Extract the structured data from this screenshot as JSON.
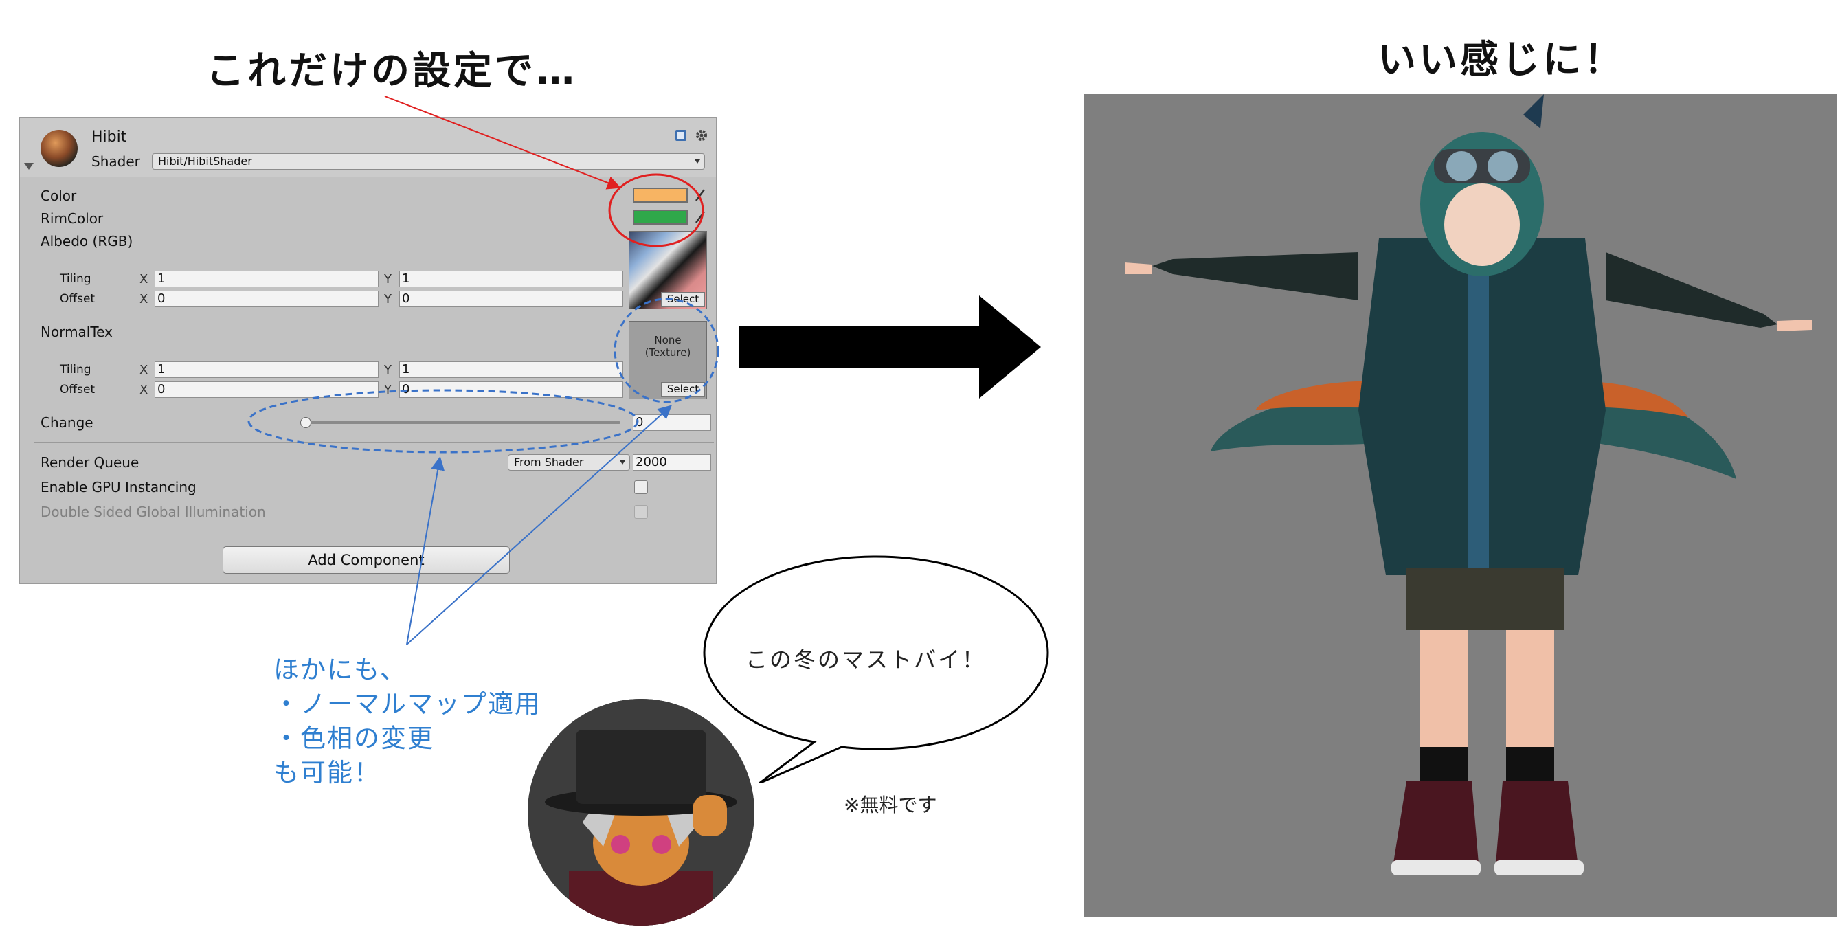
{
  "headings": {
    "left": "これだけの設定で…",
    "right": "いい感じに！"
  },
  "inspector": {
    "material_name": "Hibit",
    "shader_label": "Shader",
    "shader_value": "Hibit/HibitShader",
    "properties": {
      "color": "Color",
      "rim_color": "RimColor",
      "albedo": "Albedo (RGB)",
      "normal_tex": "NormalTex",
      "change": "Change",
      "render_queue": "Render Queue",
      "gpu_instancing": "Enable GPU Instancing",
      "double_sided_gi": "Double Sided Global Illumination"
    },
    "albedo_tiling": {
      "label": "Tiling",
      "x": "1",
      "y": "1"
    },
    "albedo_offset": {
      "label": "Offset",
      "x": "0",
      "y": "0"
    },
    "normal_tiling": {
      "label": "Tiling",
      "x": "1",
      "y": "1"
    },
    "normal_offset": {
      "label": "Offset",
      "x": "0",
      "y": "0"
    },
    "axis_x": "X",
    "axis_y": "Y",
    "texture_select": "Select",
    "normal_none": "None",
    "normal_none_type": "(Texture)",
    "change_value": "0",
    "change_slider_fraction": 0,
    "render_queue_mode": "From Shader",
    "render_queue_value": "2000",
    "gpu_instancing_checked": false,
    "double_sided_gi_checked": false,
    "add_component": "Add Component",
    "colors": {
      "color_swatch": "#f7b463",
      "rim_color_swatch": "#2fa84a"
    }
  },
  "annotations": {
    "blue_lines": [
      "ほかにも、",
      "・ノーマルマップ適用",
      "・色相の変更",
      "も可能！"
    ],
    "speech": "この冬のマストバイ！",
    "free_note": "※無料です",
    "colors": {
      "red": "#e02020",
      "blue": "#3a72c8"
    }
  },
  "big_arrow_color": "#000000",
  "render_background": "#7f7f7f"
}
